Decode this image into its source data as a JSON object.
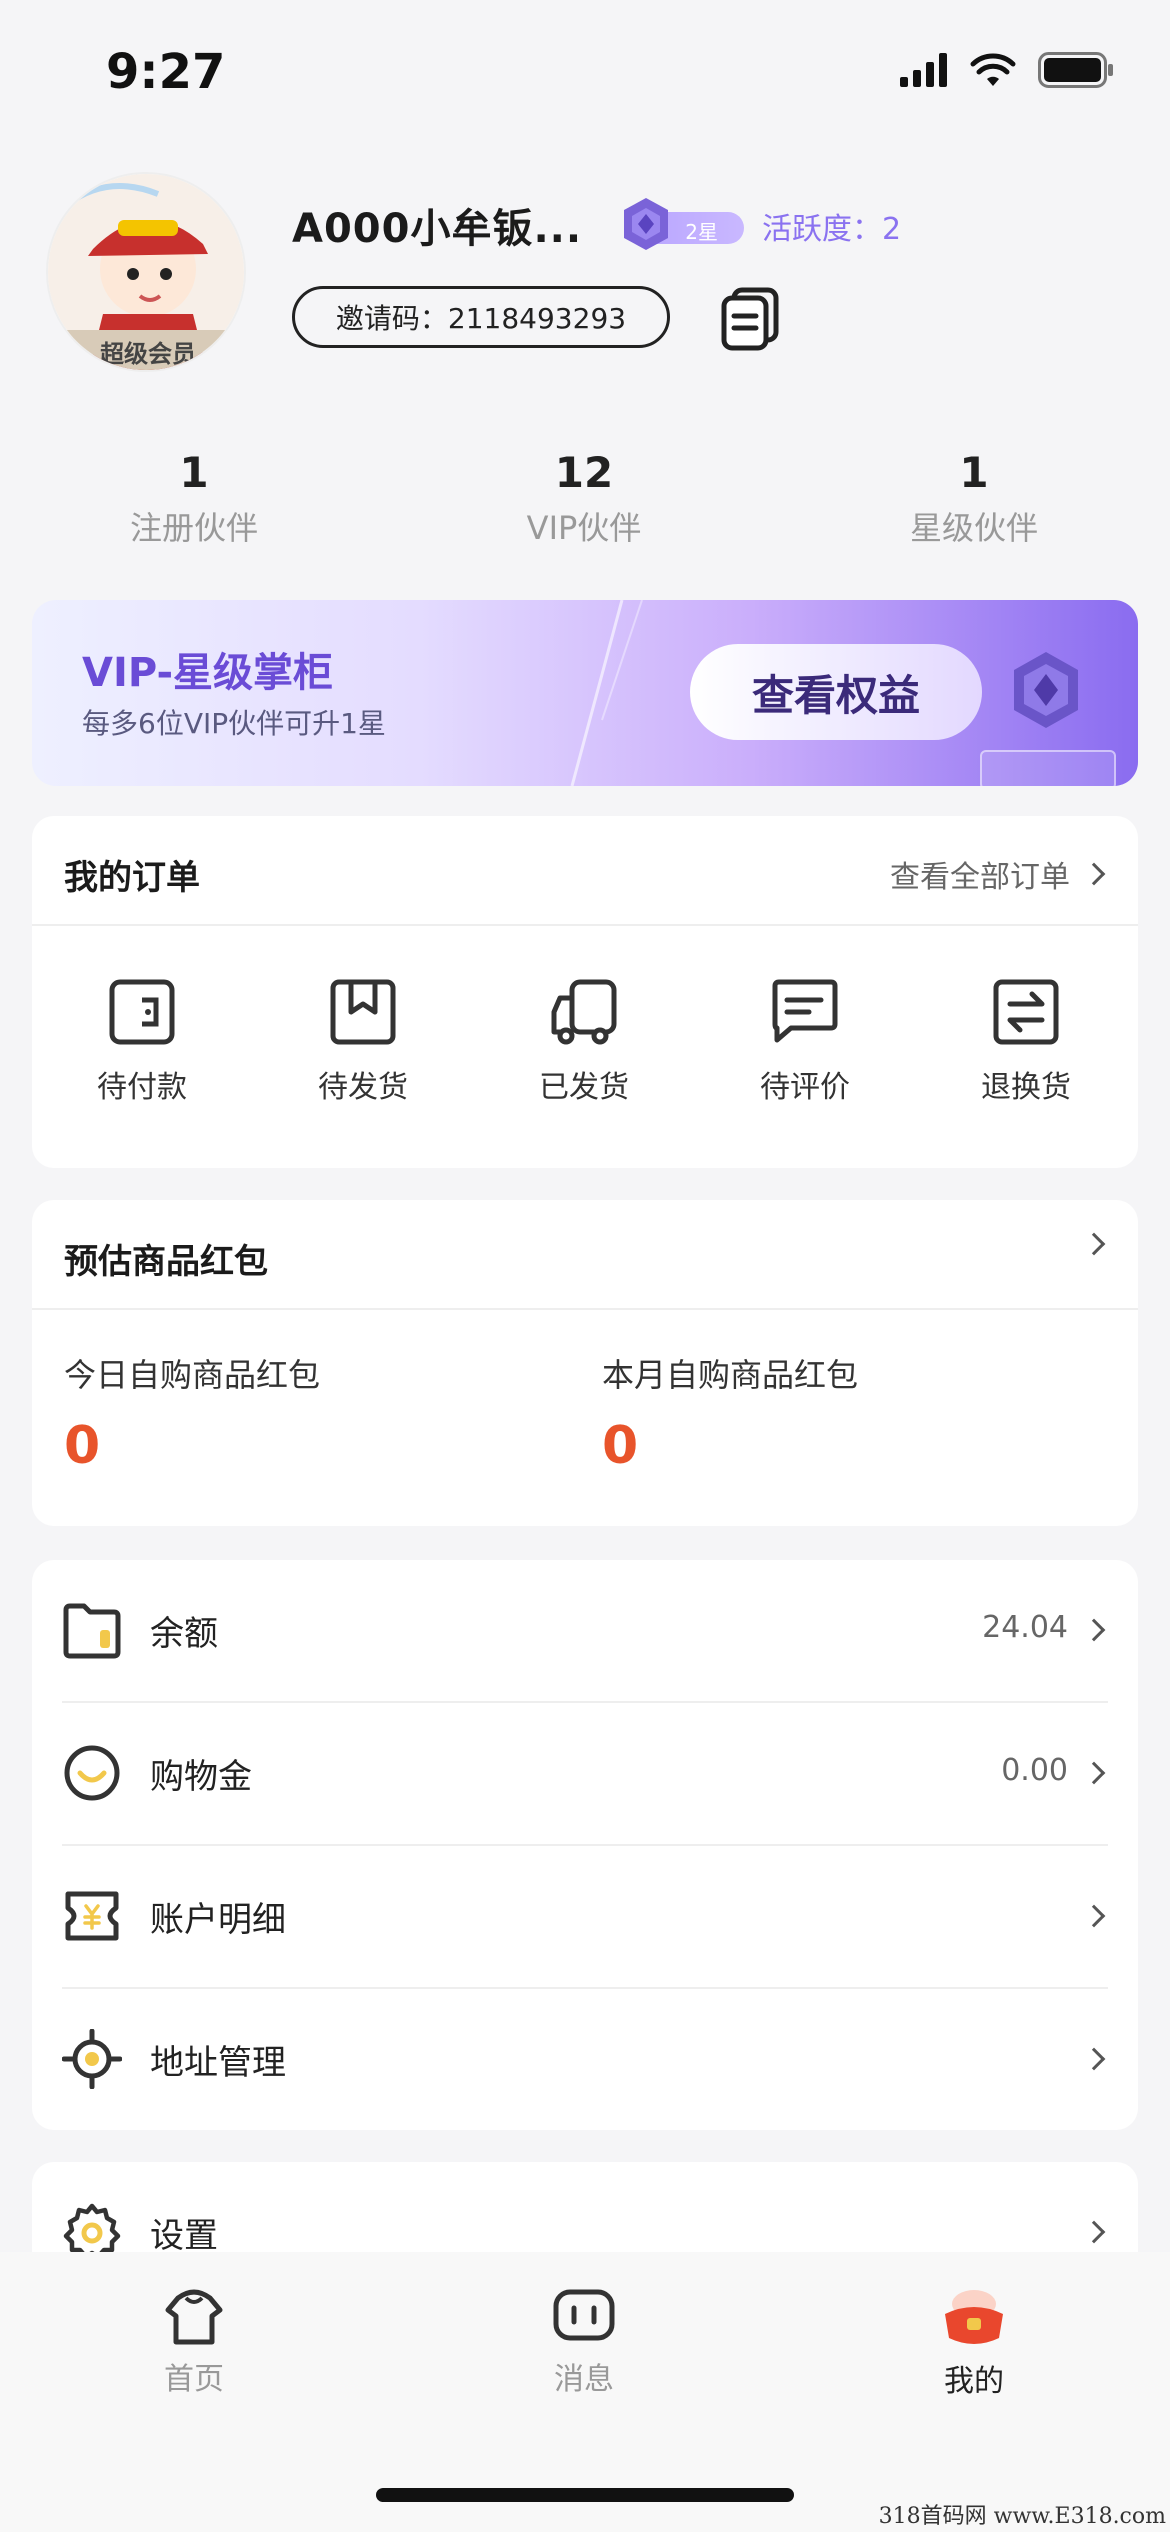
{
  "status_bar": {
    "time": "9:27"
  },
  "profile": {
    "username": "A000小牟钣...",
    "star_level": "2星",
    "activity": "活跃度：2",
    "invite_code": "邀请码：2118493293",
    "avatar_caption": "超级会员"
  },
  "stats": [
    {
      "value": "1",
      "label": "注册伙伴"
    },
    {
      "value": "12",
      "label": "VIP伙伴"
    },
    {
      "value": "1",
      "label": "星级伙伴"
    }
  ],
  "vip_banner": {
    "title": "VIP-星级掌柜",
    "subtitle": "每多6位VIP伙伴可升1星",
    "button": "查看权益"
  },
  "orders": {
    "title": "我的订单",
    "view_all": "查看全部订单",
    "items": [
      {
        "label": "待付款",
        "icon": "wallet-icon"
      },
      {
        "label": "待发货",
        "icon": "box-icon"
      },
      {
        "label": "已发货",
        "icon": "truck-icon"
      },
      {
        "label": "待评价",
        "icon": "comment-icon"
      },
      {
        "label": "退换货",
        "icon": "exchange-icon"
      }
    ]
  },
  "red_packet": {
    "title": "预估商品红包",
    "today_label": "今日自购商品红包",
    "today_value": "0",
    "month_label": "本月自购商品红包",
    "month_value": "0"
  },
  "menu": [
    {
      "label": "余额",
      "value": "24.04",
      "icon": "folder-wallet-icon"
    },
    {
      "label": "购物金",
      "value": "0.00",
      "icon": "coin-icon"
    },
    {
      "label": "账户明细",
      "value": "",
      "icon": "yuan-ticket-icon"
    },
    {
      "label": "地址管理",
      "value": "",
      "icon": "location-target-icon"
    }
  ],
  "settings": {
    "label": "设置",
    "icon": "gear-icon"
  },
  "tabs": [
    {
      "label": "首页",
      "icon": "shirt-home-icon"
    },
    {
      "label": "消息",
      "icon": "message-icon"
    },
    {
      "label": "我的",
      "icon": "mine-bag-icon"
    }
  ],
  "watermark": "318首码网 www.E318.com",
  "colors": {
    "accent_purple": "#6a4cd6",
    "value_red": "#e8542b",
    "icon_yellow": "#f2c84b"
  }
}
